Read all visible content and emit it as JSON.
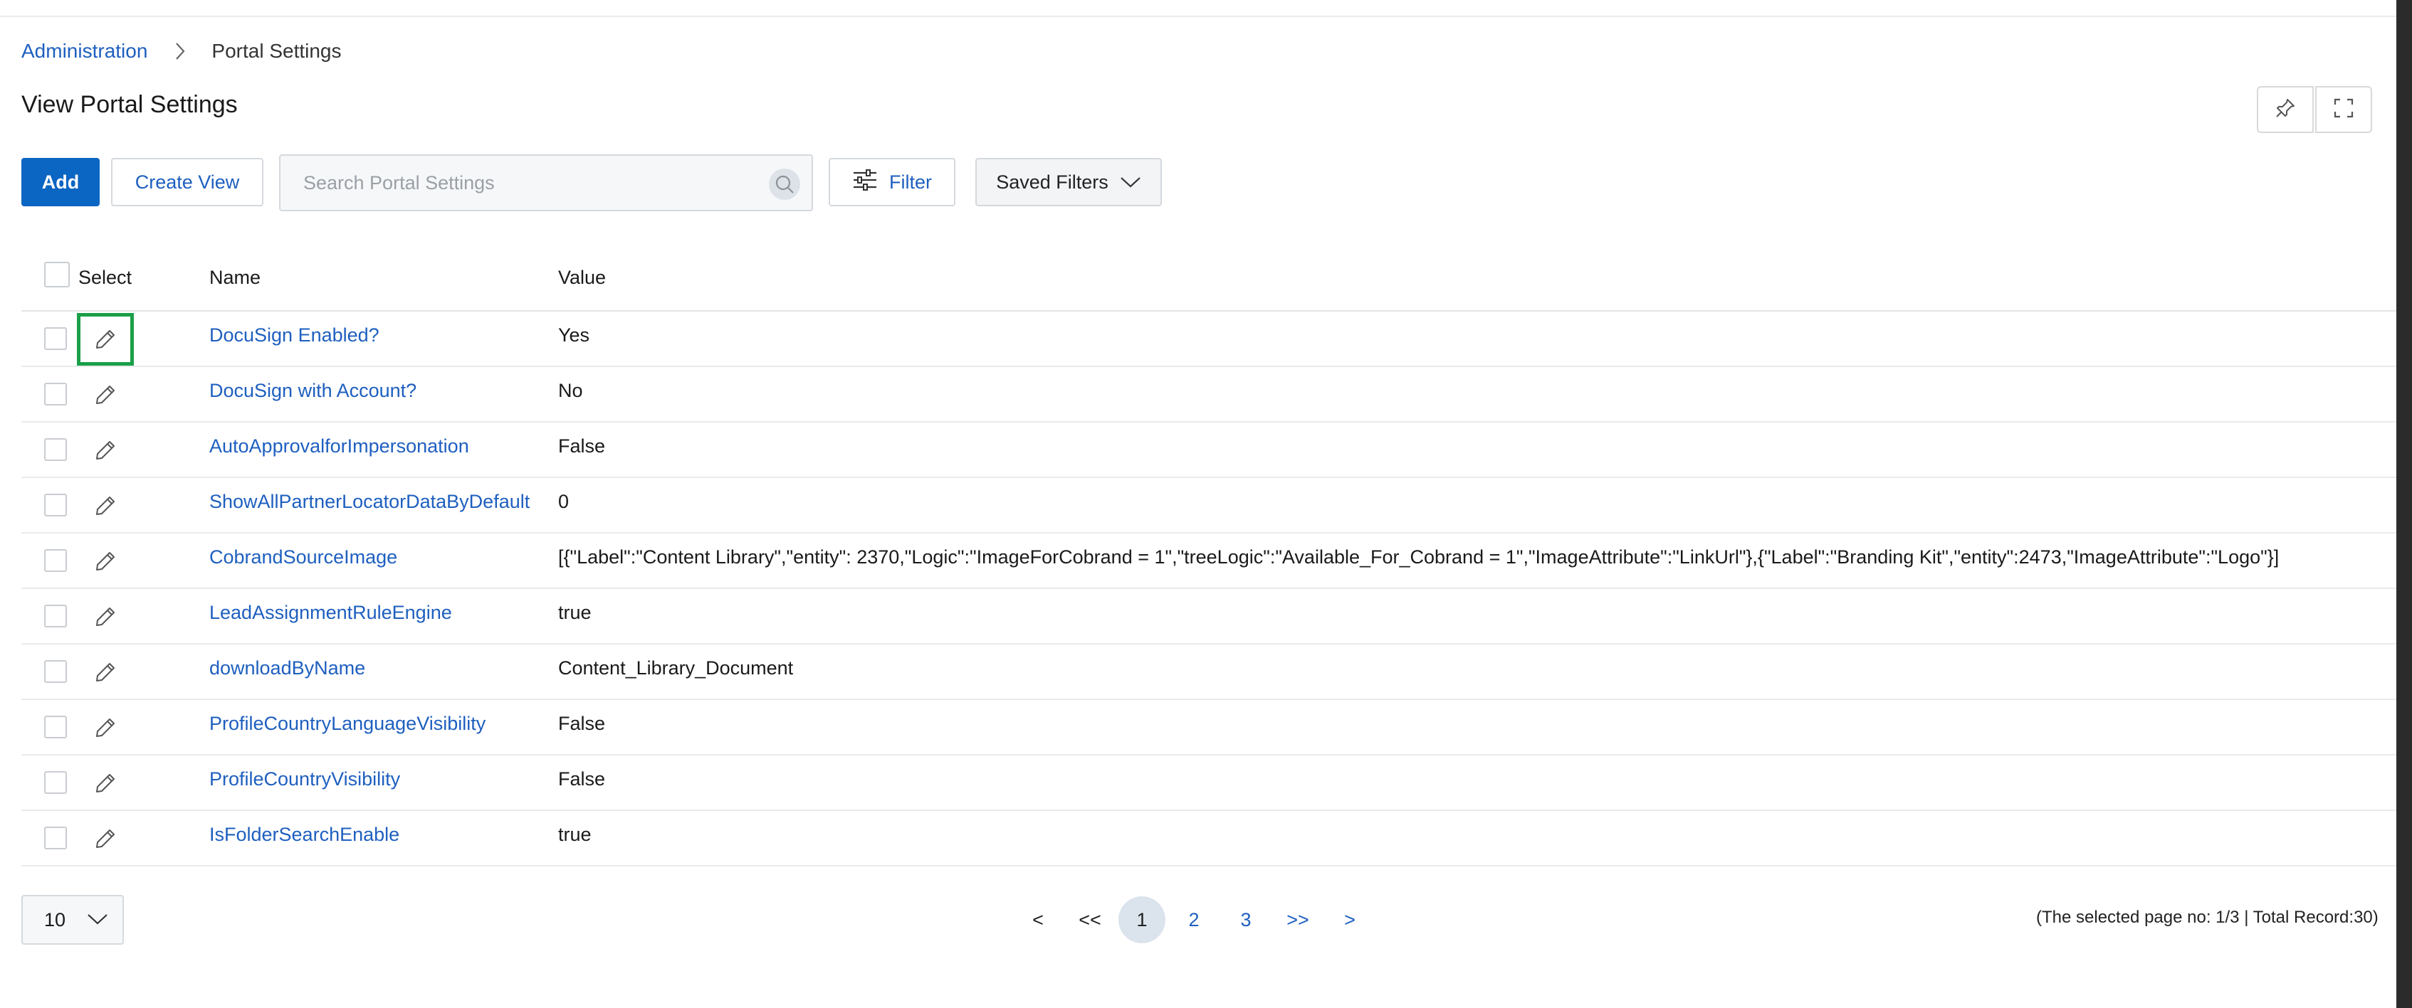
{
  "breadcrumb": {
    "parent": "Administration",
    "current": "Portal Settings"
  },
  "page_title": "View Portal Settings",
  "toolbar": {
    "add_label": "Add",
    "create_view_label": "Create View",
    "search_placeholder": "Search Portal Settings",
    "filter_label": "Filter",
    "saved_filters_label": "Saved Filters"
  },
  "table": {
    "headers": {
      "select": "Select",
      "name": "Name",
      "value": "Value"
    },
    "rows": [
      {
        "name": "DocuSign Enabled?",
        "value": "Yes"
      },
      {
        "name": "DocuSign with Account?",
        "value": "No"
      },
      {
        "name": "AutoApprovalforImpersonation",
        "value": "False"
      },
      {
        "name": "ShowAllPartnerLocatorDataByDefault",
        "value": "0"
      },
      {
        "name": "CobrandSourceImage",
        "value": "[{\"Label\":\"Content Library\",\"entity\": 2370,\"Logic\":\"ImageForCobrand = 1\",\"treeLogic\":\"Available_For_Cobrand = 1\",\"ImageAttribute\":\"LinkUrl\"},{\"Label\":\"Branding Kit\",\"entity\":2473,\"ImageAttribute\":\"Logo\"}]"
      },
      {
        "name": "LeadAssignmentRuleEngine",
        "value": "true"
      },
      {
        "name": "downloadByName",
        "value": "Content_Library_Document"
      },
      {
        "name": "ProfileCountryLanguageVisibility",
        "value": "False"
      },
      {
        "name": "ProfileCountryVisibility",
        "value": "False"
      },
      {
        "name": "IsFolderSearchEnable",
        "value": "true"
      }
    ]
  },
  "pagination": {
    "page_size": "10",
    "prev": "<",
    "first": "<<",
    "pages": [
      "1",
      "2",
      "3"
    ],
    "last": ">>",
    "next": ">",
    "status": "(The selected page no: 1/3 | Total Record:30)"
  },
  "colors": {
    "accent": "#0b65c2",
    "link": "#1e5fbf",
    "focus_outline": "#1a9f48"
  },
  "icons": {
    "breadcrumb_separator": "chevron-right-icon",
    "pin": "pin-icon",
    "expand": "fullscreen-icon",
    "search": "search-icon",
    "filter": "sliders-icon",
    "dropdown": "chevron-down-icon",
    "edit": "pencil-icon"
  }
}
